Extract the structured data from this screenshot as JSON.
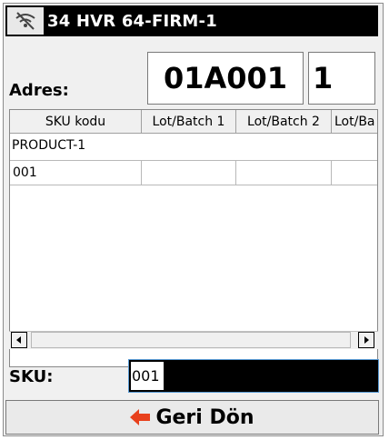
{
  "window": {
    "title": "34 HVR 64-FIRM-1",
    "icon": "no-signal-icon"
  },
  "address": {
    "label": "Adres:",
    "code": "01A001",
    "number": "1"
  },
  "grid": {
    "columns": [
      "SKU kodu",
      "Lot/Batch 1",
      "Lot/Batch 2",
      "Lot/Ba"
    ],
    "group": "PRODUCT-1",
    "rows": [
      [
        "001",
        "",
        "",
        ""
      ]
    ]
  },
  "sku": {
    "label": "SKU:",
    "value": "001"
  },
  "back_button": {
    "label": "Geri Dön",
    "icon": "arrow-left-icon"
  },
  "colors": {
    "title_bg": "#000000",
    "back_arrow": "#e8401c",
    "input_focus": "#5a9bd5"
  }
}
